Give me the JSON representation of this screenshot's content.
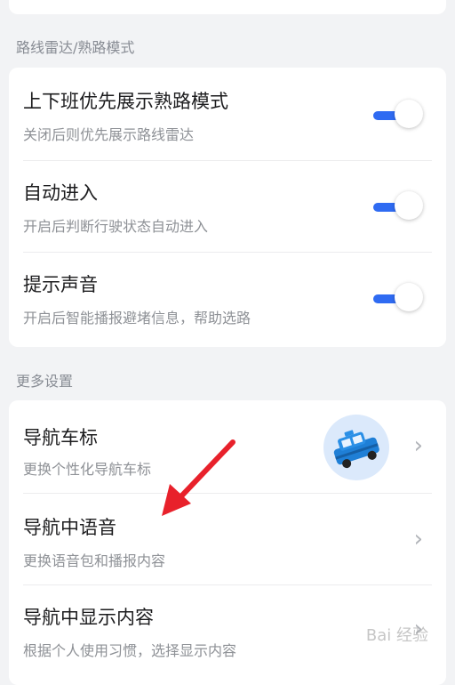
{
  "sections": {
    "route_radar": {
      "title": "路线雷达/熟路模式",
      "items": [
        {
          "title": "上下班优先展示熟路模式",
          "subtitle": "关闭后则优先展示路线雷达",
          "toggle": "on"
        },
        {
          "title": "自动进入",
          "subtitle": "开启后判断行驶状态自动进入",
          "toggle": "on"
        },
        {
          "title": "提示声音",
          "subtitle": "开启后智能播报避堵信息，帮助选路",
          "toggle": "on"
        }
      ]
    },
    "more": {
      "title": "更多设置",
      "items": [
        {
          "title": "导航车标",
          "subtitle": "更换个性化导航车标",
          "chevron": "›"
        },
        {
          "title": "导航中语音",
          "subtitle": "更换语音包和播报内容",
          "chevron": "›"
        },
        {
          "title": "导航中显示内容",
          "subtitle": "根据个人使用习惯，选择显示内容",
          "chevron": "›"
        }
      ]
    }
  },
  "colors": {
    "accent": "#2f6bf2",
    "annotation_arrow": "#e8212b"
  },
  "watermark": "Bai 经验"
}
